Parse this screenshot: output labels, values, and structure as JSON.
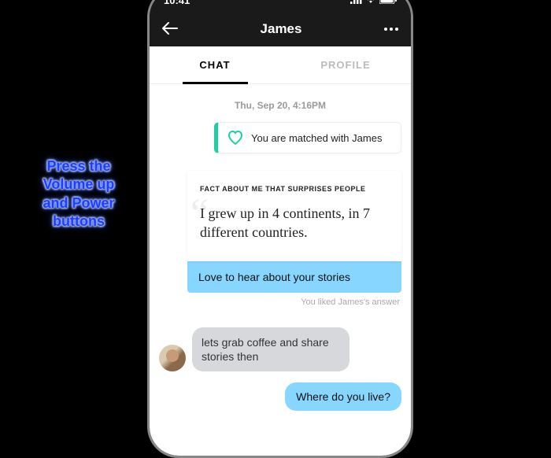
{
  "instruction_text": "Press the Volume up and Power buttons",
  "status": {
    "time": "10:41"
  },
  "nav": {
    "title": "James"
  },
  "tabs": {
    "chat": "CHAT",
    "profile": "PROFILE"
  },
  "timestamp": "Thu, Sep 20, 4:16PM",
  "match_text": "You are matched with James",
  "fact": {
    "heading": "FACT ABOUT ME THAT SURPRISES PEOPLE",
    "body": "I grew up in 4 continents, in 7 different countries."
  },
  "sent1": "Love to hear about your stories",
  "caption": "You liked James's answer",
  "received1": "lets grab coffee and share stories then",
  "sent2": "Where do you live?"
}
